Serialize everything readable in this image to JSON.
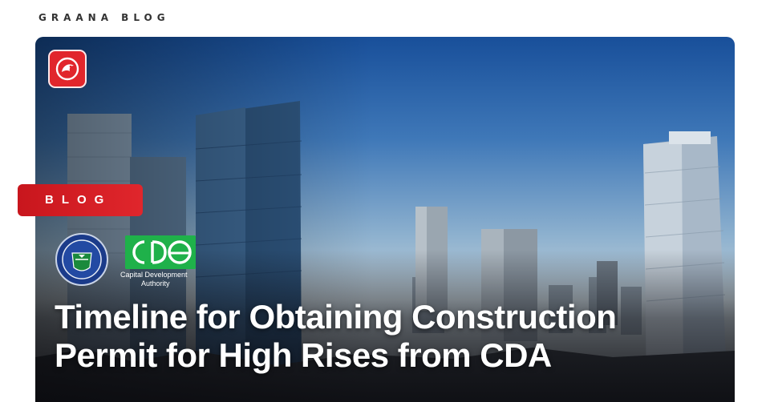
{
  "brand": {
    "name": "GRAANA BLOG"
  },
  "hero": {
    "tag_label": "BLOG",
    "title_lines": [
      "Timeline for Obtaining Construction",
      "Permit for High Rises from CDA"
    ],
    "cda": {
      "caption_line1": "Capital Development",
      "caption_line2": "Authority"
    },
    "icons": {
      "brand_logo": "graana-bird-icon",
      "emblem": "islamabad-emblem-icon",
      "cda_logo": "cda-logo-icon"
    }
  },
  "colors": {
    "accent": "#e1262c",
    "cda_green": "#1fb14a",
    "text_on_image": "#ffffff",
    "brand_text": "#333333"
  }
}
